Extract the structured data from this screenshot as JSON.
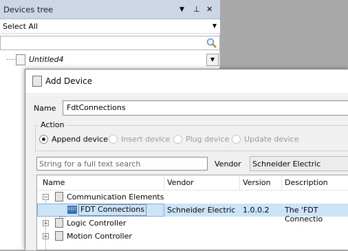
{
  "devices_tree": {
    "title": "Devices tree",
    "buttons": {
      "dropdown": "▼",
      "pin": "⊥",
      "close": "✕"
    },
    "select_all": {
      "value": "Select All"
    },
    "search": {
      "value": ""
    },
    "root_item": {
      "label": "Untitled4"
    }
  },
  "dialog": {
    "title": "Add Device",
    "name_label": "Name",
    "name_value": "FdtConnections",
    "action": {
      "label": "Action",
      "options": [
        {
          "label": "Append device",
          "selected": true,
          "enabled": true
        },
        {
          "label": "Insert device",
          "selected": false,
          "enabled": false
        },
        {
          "label": "Plug device",
          "selected": false,
          "enabled": false
        },
        {
          "label": "Update device",
          "selected": false,
          "enabled": false
        }
      ]
    },
    "search_placeholder": "String for a full text search",
    "vendor_label": "Vendor",
    "vendor_value": "Schneider Electric",
    "columns": [
      "Name",
      "Vendor",
      "Version",
      "Description"
    ],
    "rows": [
      {
        "name": "Communication Elements",
        "expander": "−",
        "vendor": "",
        "version": "",
        "description": ""
      },
      {
        "name": "FDT Connections",
        "icon_text": "FDT",
        "vendor": "Schneider Electric",
        "version": "1.0.0.2",
        "description": "The 'FDT Connectio"
      },
      {
        "name": "Logic Controller",
        "expander": "+",
        "vendor": "",
        "version": "",
        "description": ""
      },
      {
        "name": "Motion Controller",
        "expander": "+",
        "vendor": "",
        "version": "",
        "description": ""
      }
    ]
  },
  "colors": {
    "accent_selected": "#cce4f7",
    "panel_title": "#ccd6e6",
    "background": "#a9a9a9"
  }
}
